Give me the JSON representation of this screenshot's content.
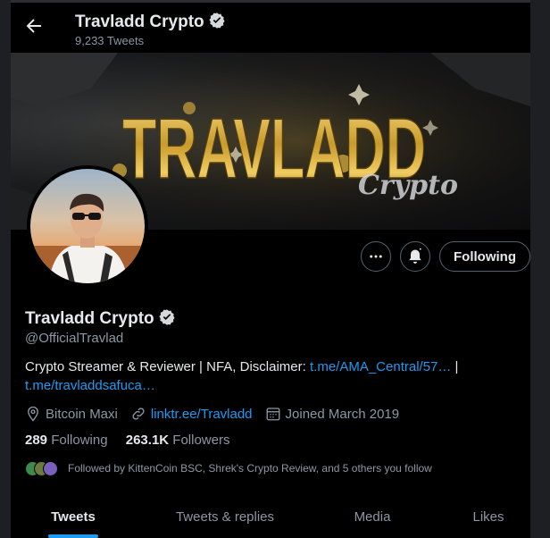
{
  "header": {
    "name": "Travladd Crypto",
    "tweet_count": "9,233 Tweets"
  },
  "banner": {
    "title_text": "TRAVLADD",
    "subtitle_text": "Crypto"
  },
  "actions": {
    "following_label": "Following"
  },
  "profile": {
    "name": "Travladd Crypto",
    "handle": "@OfficialTravlad",
    "bio_text": "Crypto Streamer & Reviewer | NFA, Disclaimer: ",
    "bio_link1": "t.me/AMA_Central/57…",
    "bio_sep": " |",
    "bio_link2": "t.me/travladdsafuca…",
    "location": "Bitcoin Maxi",
    "website": "linktr.ee/Travladd",
    "joined": "Joined March 2019",
    "following_count": "289",
    "following_label": "Following",
    "followers_count": "263.1K",
    "followers_label": "Followers",
    "followed_by": "Followed by KittenCoin BSC, Shrek's Crypto Review, and 5 others you follow"
  },
  "tabs": [
    {
      "label": "Tweets",
      "active": true
    },
    {
      "label": "Tweets & replies",
      "active": false
    },
    {
      "label": "Media",
      "active": false
    },
    {
      "label": "Likes",
      "active": false
    }
  ],
  "colors": {
    "accent": "#1d9bf0",
    "background": "#000000",
    "secondary_text": "#8b98a5",
    "gold": "#c9a23a"
  },
  "icons": [
    "back-arrow-icon",
    "verified-badge-icon",
    "more-icon",
    "notification-bell-icon",
    "location-icon",
    "link-icon",
    "calendar-icon"
  ]
}
